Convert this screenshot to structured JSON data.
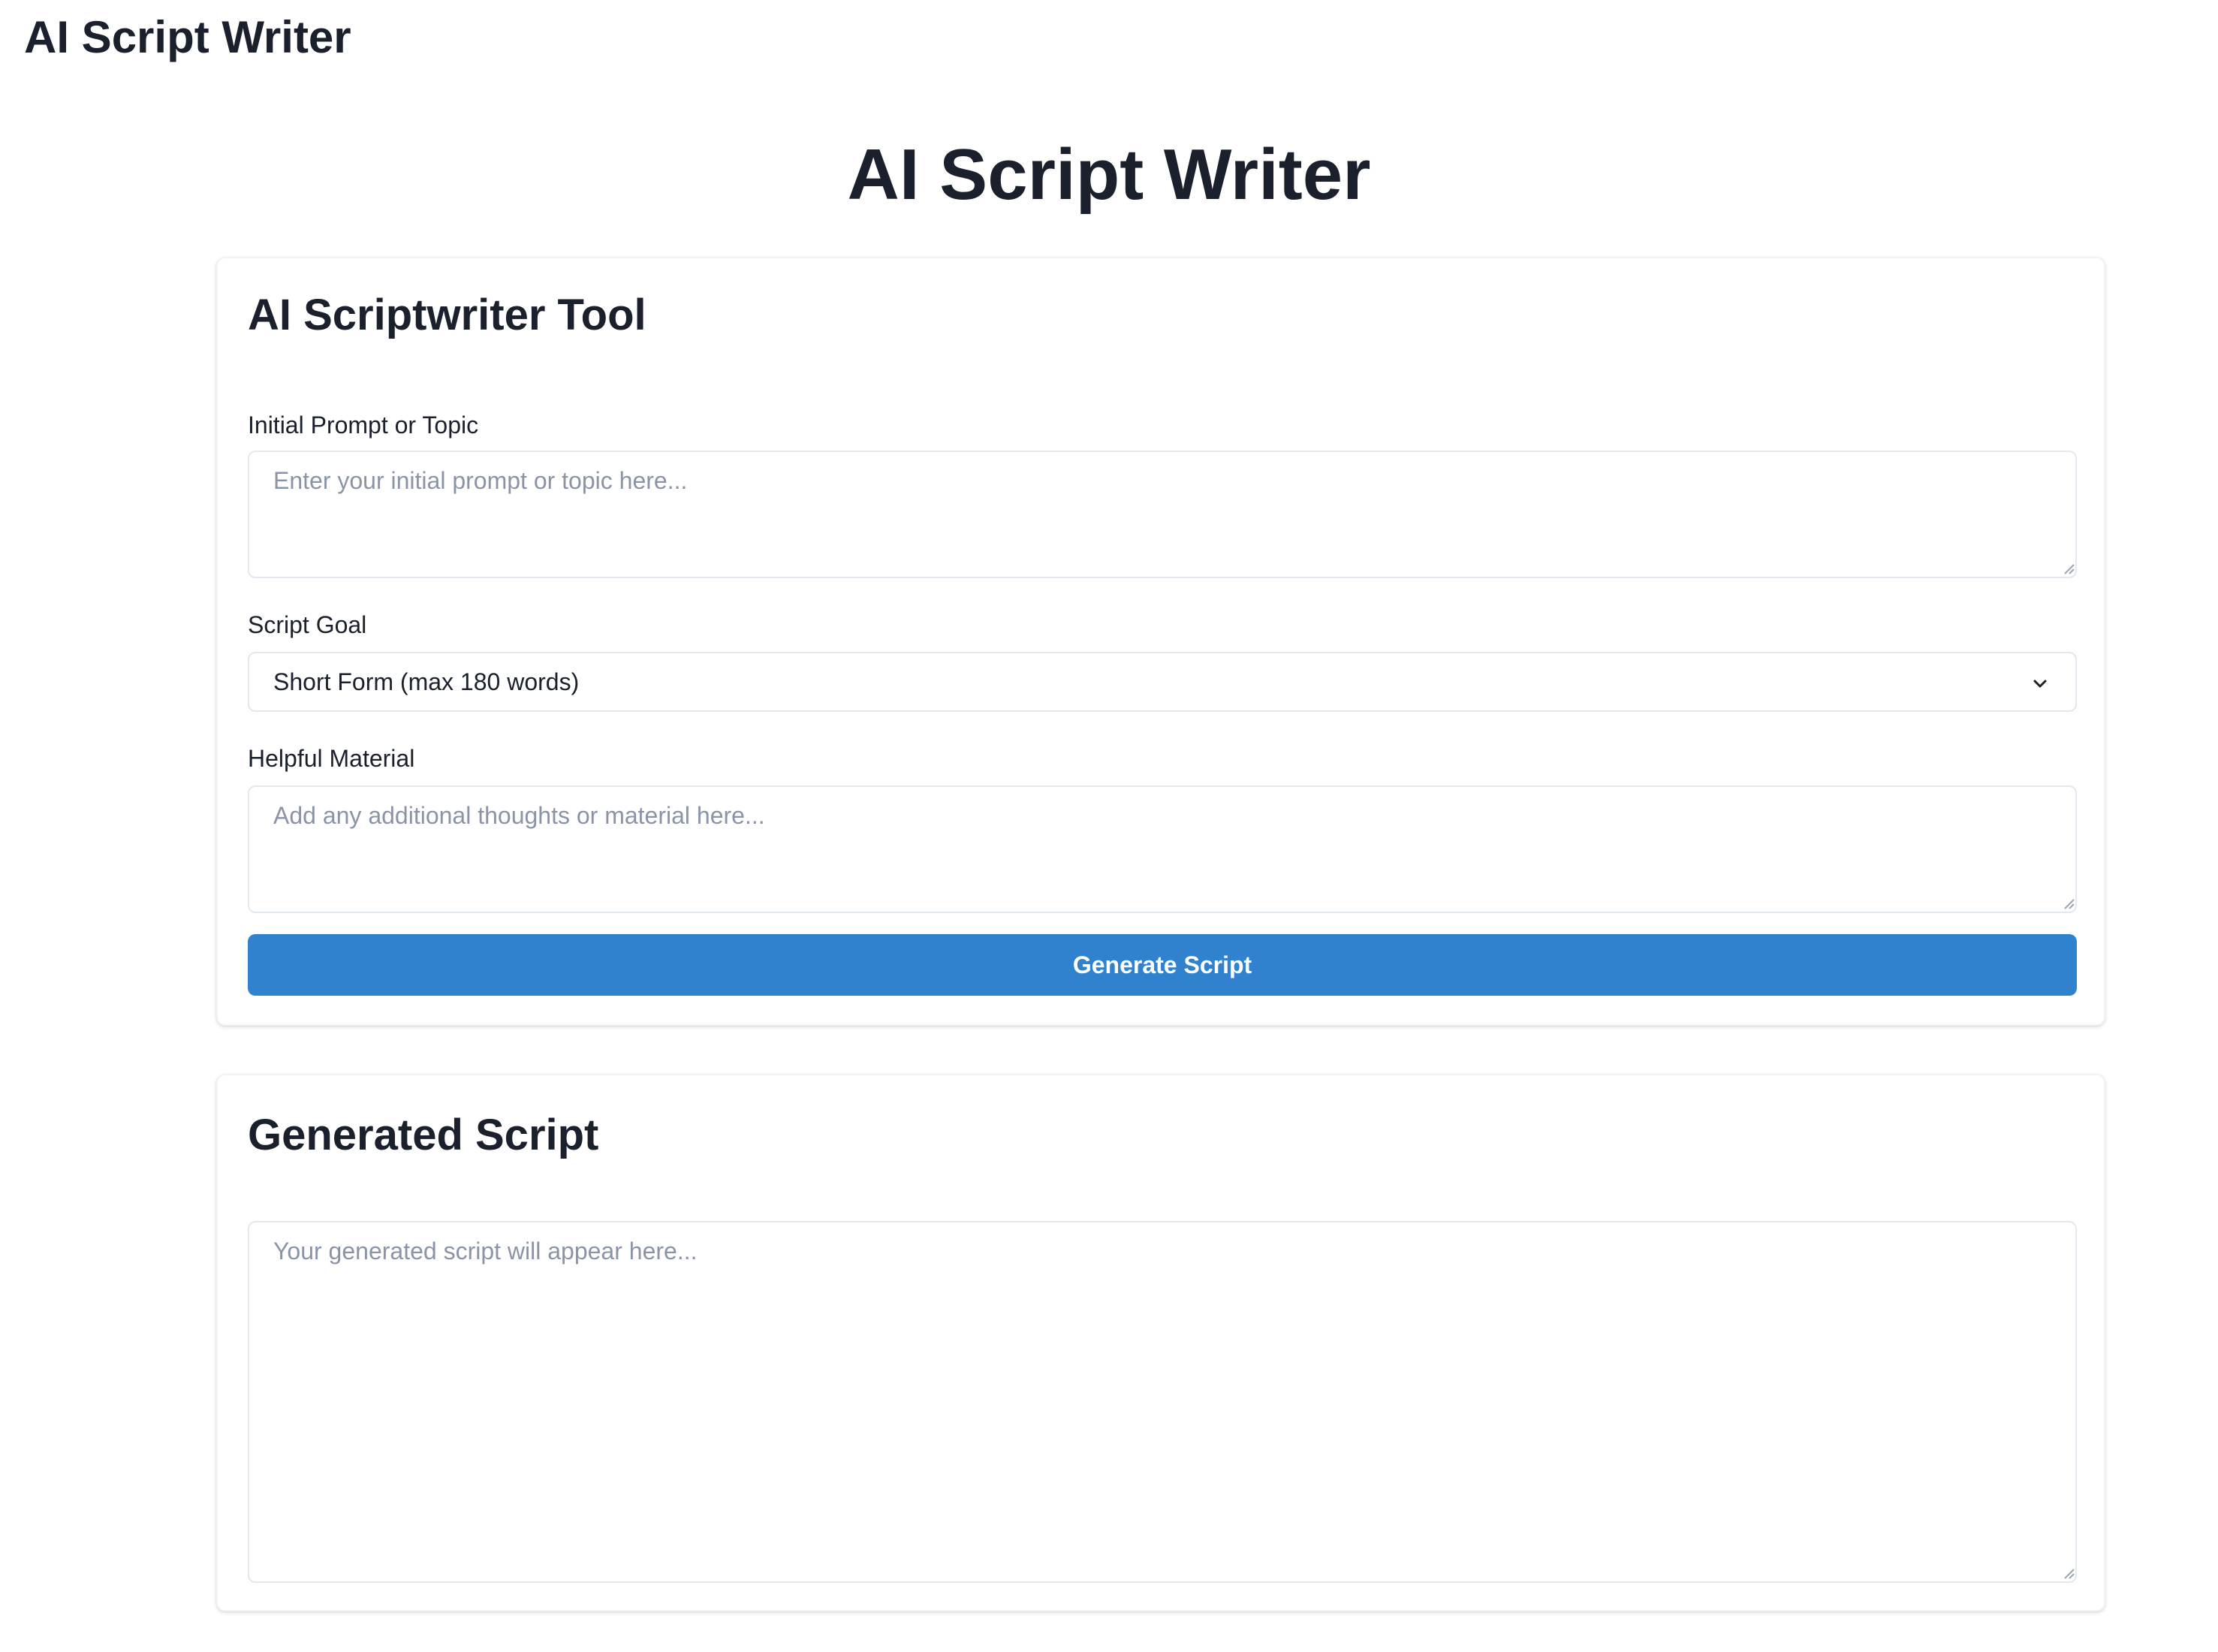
{
  "app": {
    "header_title": "AI Script Writer",
    "page_title": "AI Script Writer"
  },
  "tool_card": {
    "title": "AI Scriptwriter Tool",
    "prompt": {
      "label": "Initial Prompt or Topic",
      "placeholder": "Enter your initial prompt or topic here...",
      "value": ""
    },
    "goal": {
      "label": "Script Goal",
      "selected": "Short Form (max 180 words)",
      "icon": "chevron-down-icon"
    },
    "material": {
      "label": "Helpful Material",
      "placeholder": "Add any additional thoughts or material here...",
      "value": ""
    },
    "generate_button": {
      "label": "Generate Script",
      "color": "#3182ce"
    }
  },
  "output_card": {
    "title": "Generated Script",
    "output": {
      "placeholder": "Your generated script will appear here...",
      "value": ""
    }
  },
  "colors": {
    "text": "#1a202c",
    "placeholder": "#8a94a6",
    "border": "#e2e8f0",
    "accent": "#3182ce"
  }
}
